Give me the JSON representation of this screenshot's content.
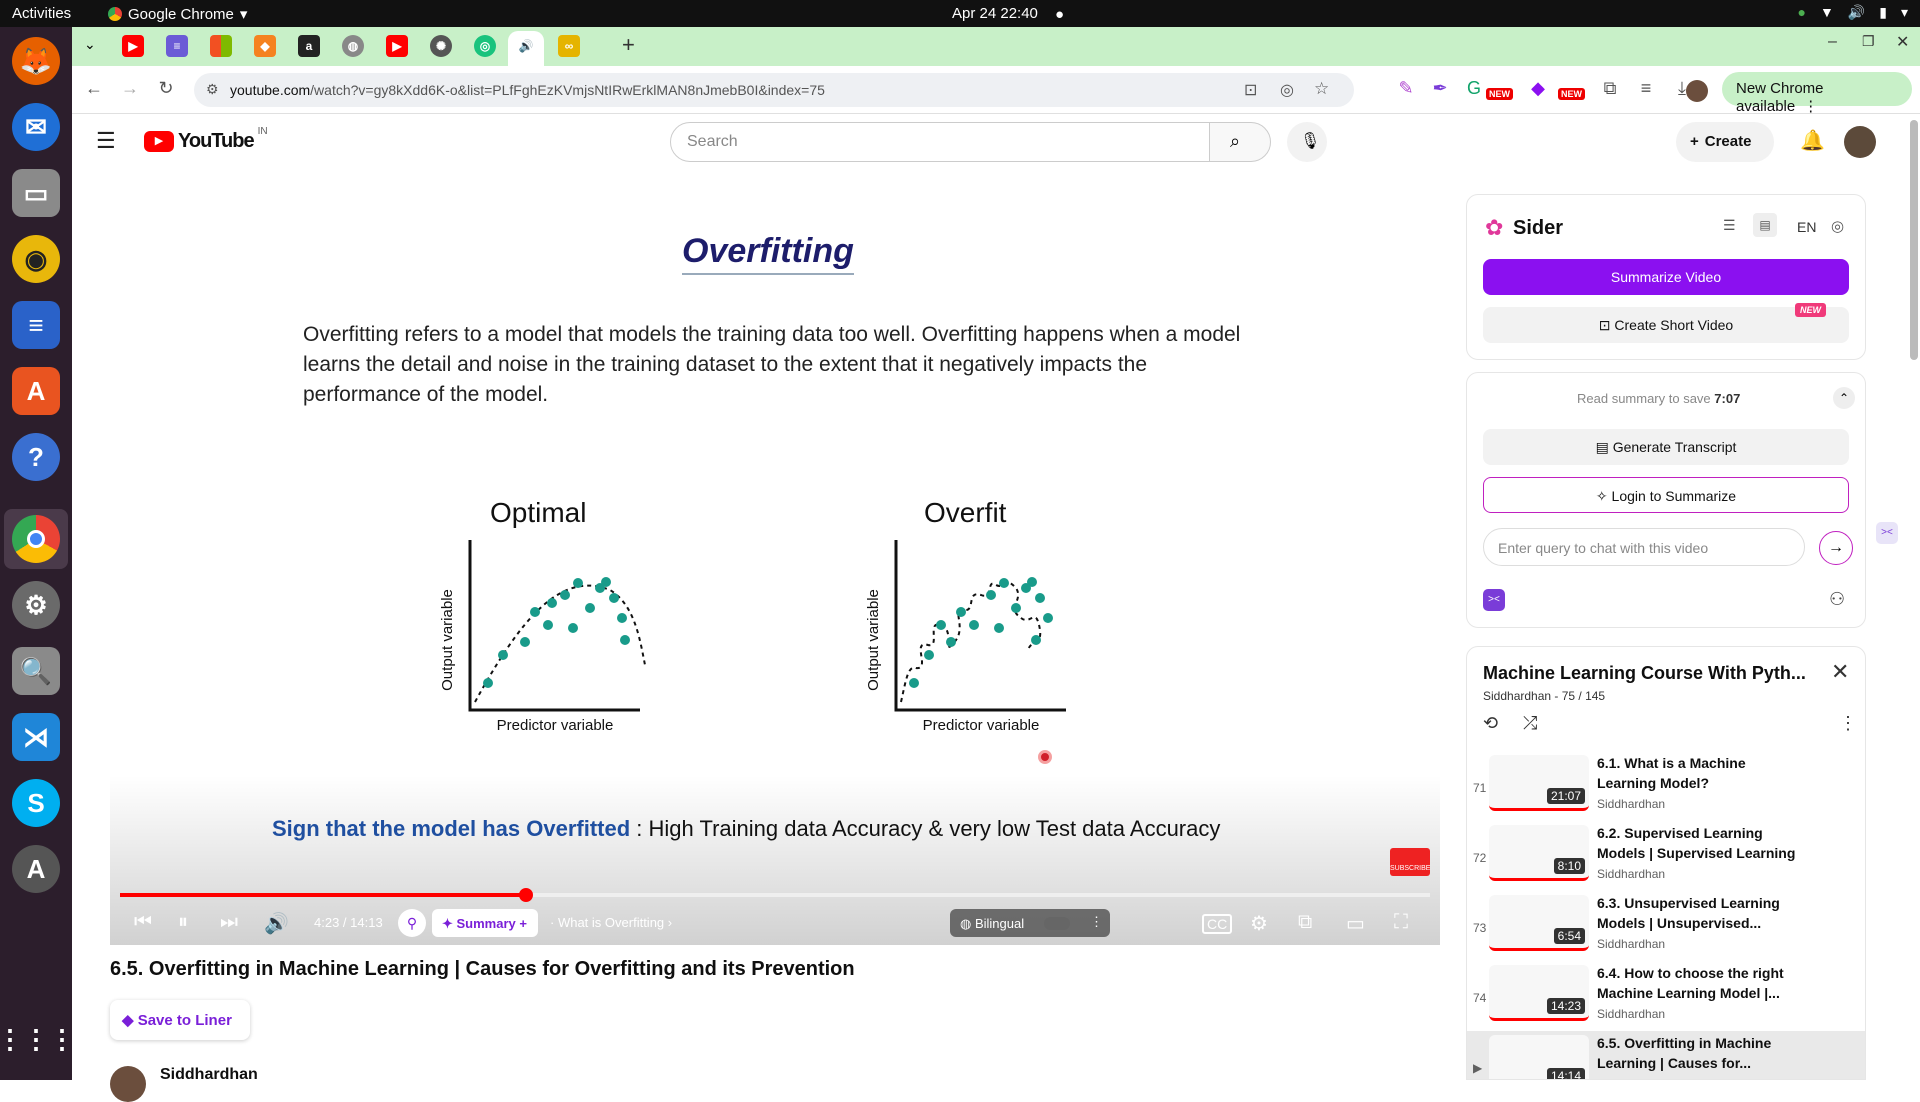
{
  "os": {
    "activities": "Activities",
    "app_name": "Google Chrome",
    "clock": "Apr 24  22:40"
  },
  "browser": {
    "url_host": "youtube.com",
    "url_rest": "/watch?v=gy8kXdd6K-o&list=PLfFghEzKVmjsNtIRwErklMAN8nJmebB0I&index=75",
    "new_chrome": "New Chrome available",
    "badge_new": "NEW"
  },
  "youtube": {
    "logo": "YouTube",
    "region": "IN",
    "search_placeholder": "Search",
    "create": "Create"
  },
  "video": {
    "slide_title": "Overfitting",
    "slide_text": "Overfitting refers to a model that models the training data too well. Overfitting happens when a model learns the detail and noise in the training dataset to the extent that it negatively impacts the performance of the model.",
    "plot_left_title": "Optimal",
    "plot_right_title": "Overfit",
    "ylabel": "Output variable",
    "xlabel": "Predictor variable",
    "sign_highlight": "Sign that the model has Overfitted",
    "sign_rest": " : High Training data Accuracy & very low Test data Accuracy",
    "subscribe": "SUBSCRIBE",
    "time": "4:23 / 14:13",
    "summary": "Summary +",
    "chapter": "What is Overfitting",
    "bilingual": "Bilingual",
    "progress_fraction": 0.31
  },
  "below_video": {
    "title": "6.5. Overfitting in Machine Learning | Causes for Overfitting and its Prevention",
    "save_liner": "Save to Liner",
    "channel": "Siddhardhan"
  },
  "sider": {
    "brand": "Sider",
    "lang": "EN",
    "summarize": "Summarize Video",
    "short_video": "Create Short Video",
    "new_badge": "NEW",
    "read_summary": "Read summary to save",
    "read_summary_time": "7:07",
    "transcript": "Generate Transcript",
    "login": "Login to Summarize",
    "chat_placeholder": "Enter query to chat with this video"
  },
  "playlist": {
    "title": "Machine Learning Course With Pyth...",
    "meta": "Siddhardhan - 75 / 145",
    "items": [
      {
        "num": "71",
        "title": "6.1. What is a Machine Learning Model?",
        "channel": "Siddhardhan",
        "duration": "21:07"
      },
      {
        "num": "72",
        "title": "6.2. Supervised Learning Models | Supervised Learning",
        "channel": "Siddhardhan",
        "duration": "8:10"
      },
      {
        "num": "73",
        "title": "6.3. Unsupervised Learning Models | Unsupervised...",
        "channel": "Siddhardhan",
        "duration": "6:54"
      },
      {
        "num": "74",
        "title": "6.4. How to choose the right Machine Learning Model |...",
        "channel": "Siddhardhan",
        "duration": "14:23"
      },
      {
        "num": "▶",
        "title": "6.5. Overfitting in Machine Learning | Causes for...",
        "channel": "",
        "duration": "14:14"
      }
    ]
  },
  "colors": {
    "yt_red": "#ff0000",
    "sider_purple": "#8b10f0",
    "tabstrip": "#c8f0c8",
    "dock": "#2c1e2c"
  }
}
